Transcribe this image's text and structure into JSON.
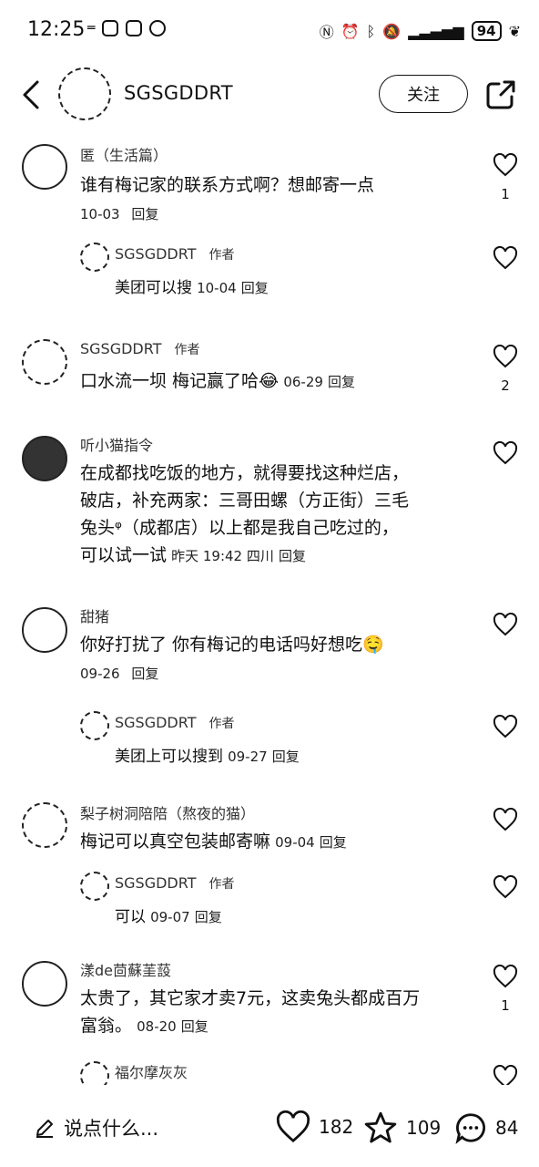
{
  "status": {
    "time": "12:25",
    "battery": "94"
  },
  "header": {
    "name": "SGSGDDRT",
    "follow": "关注"
  },
  "comments": [
    {
      "user": "匿（生活篇）",
      "text": "谁有梅记家的联系方式啊？想邮寄一点",
      "date": "10-03",
      "reply": "回复",
      "likes": "1",
      "sub": {
        "user": "SGSGDDRT",
        "tag": "作者",
        "text": "美团可以搜",
        "date": "10-04",
        "reply": "回复"
      }
    },
    {
      "user": "SGSGDDRT",
      "tag": "作者",
      "text": "口水流一坝 梅记赢了哈😂",
      "date": "06-29",
      "reply": "回复",
      "likes": "2"
    },
    {
      "user": "听小猫指令",
      "text_lines": [
        "在成都找吃饭的地方，就得要找这种烂店，",
        "破店，补充两家：三哥田螺（方正街）三毛",
        "兔头ᵠ（成都店）以上都是我自己吃过的，",
        "可以试一试"
      ],
      "date": "昨天 19:42 四川",
      "reply": "回复"
    },
    {
      "user": "甜猪",
      "text": "你好打扰了 你有梅记的电话吗好想吃🤤",
      "date": "09-26",
      "reply": "回复",
      "sub": {
        "user": "SGSGDDRT",
        "tag": "作者",
        "text": "美团上可以搜到",
        "date": "09-27",
        "reply": "回复"
      }
    },
    {
      "user": "梨子树洞陪陪（熬夜的猫）",
      "text": "梅记可以真空包装邮寄嘛",
      "date": "09-04",
      "reply": "回复",
      "sub": {
        "user": "SGSGDDRT",
        "tag": "作者",
        "text": "可以",
        "date": "09-07",
        "reply": "回复"
      }
    },
    {
      "user": "漾de茴蘇茥蔎",
      "text_lines": [
        "太贵了，其它家才卖7元，这卖兔头都成百万",
        "富翁。"
      ],
      "date": "08-20",
      "reply": "回复",
      "likes": "1",
      "sub": {
        "user": "福尔摩灰灰"
      }
    }
  ],
  "bottom": {
    "input_placeholder": "说点什么...",
    "likes": "182",
    "stars": "109",
    "comments": "84"
  }
}
